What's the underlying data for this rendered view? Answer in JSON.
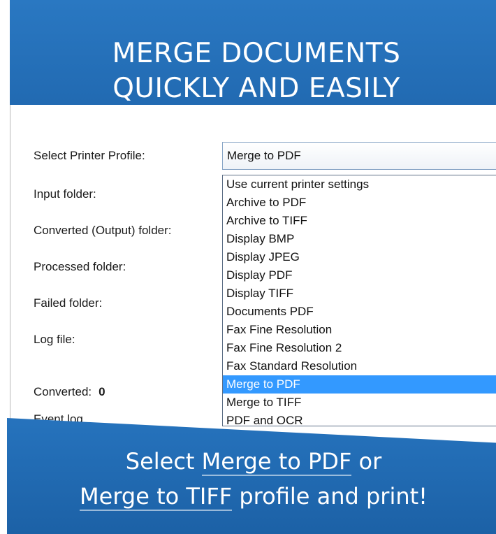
{
  "headline": {
    "line1": "MERGE DOCUMENTS",
    "line2": "QUICKLY AND EASILY"
  },
  "form": {
    "printer_profile_label": "Select Printer Profile:",
    "input_folder_label": "Input folder:",
    "output_folder_label": "Converted (Output) folder:",
    "processed_folder_label": "Processed folder:",
    "failed_folder_label": "Failed folder:",
    "log_file_label": "Log file:",
    "converted_label": "Converted:",
    "converted_count": "0",
    "event_log_label": "Event log"
  },
  "profile_combo": {
    "selected": "Merge to PDF",
    "options": [
      "Use current printer settings",
      "Archive to PDF",
      "Archive to TIFF",
      "Display BMP",
      "Display JPEG",
      "Display PDF",
      "Display TIFF",
      "Documents PDF",
      "Fax Fine Resolution",
      "Fax Fine Resolution 2",
      "Fax Standard Resolution",
      "Merge to PDF",
      "Merge to TIFF",
      "PDF and OCR"
    ],
    "selected_index": 11
  },
  "footer": {
    "select": "Select",
    "merge_pdf": "Merge to PDF",
    "or": "or",
    "merge_tiff": "Merge to TIFF",
    "tail": "profile and print!"
  },
  "colors": {
    "banner_blue": "#1f66ad",
    "selection_blue": "#3399ff"
  }
}
